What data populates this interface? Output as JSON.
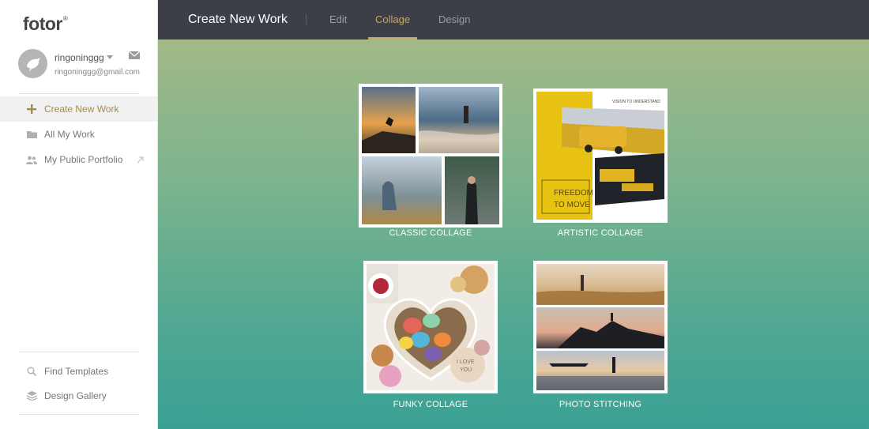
{
  "brand": {
    "name": "fotor",
    "mark": "®"
  },
  "user": {
    "name": "ringoninggg",
    "email": "ringoninggg@gmail.com"
  },
  "sidebar": {
    "items": [
      {
        "label": "Create New Work",
        "icon": "plus-icon"
      },
      {
        "label": "All My Work",
        "icon": "folder-icon"
      },
      {
        "label": "My Public Portfolio",
        "icon": "users-icon"
      }
    ],
    "bottom_items": [
      {
        "label": "Find Templates",
        "icon": "search-icon"
      },
      {
        "label": "Design Gallery",
        "icon": "layers-icon"
      }
    ]
  },
  "topbar": {
    "title": "Create New Work",
    "tabs": [
      {
        "label": "Edit"
      },
      {
        "label": "Collage"
      },
      {
        "label": "Design"
      }
    ],
    "active_tab": "Collage"
  },
  "cards": [
    {
      "label": "CLASSIC COLLAGE"
    },
    {
      "label": "ARTISTIC COLLAGE",
      "caption_small": "VISION TO UNDERSTAND",
      "caption_big_1": "FREEDOM",
      "caption_big_2": "TO MOVE"
    },
    {
      "label": "FUNKY COLLAGE",
      "candy_text_1": "I LOVE",
      "candy_text_2": "YOU"
    },
    {
      "label": "PHOTO STITCHING"
    }
  ],
  "colors": {
    "accent": "#c2a96c",
    "topbar": "#3c3f47",
    "active_nav": "#a58c4e"
  }
}
